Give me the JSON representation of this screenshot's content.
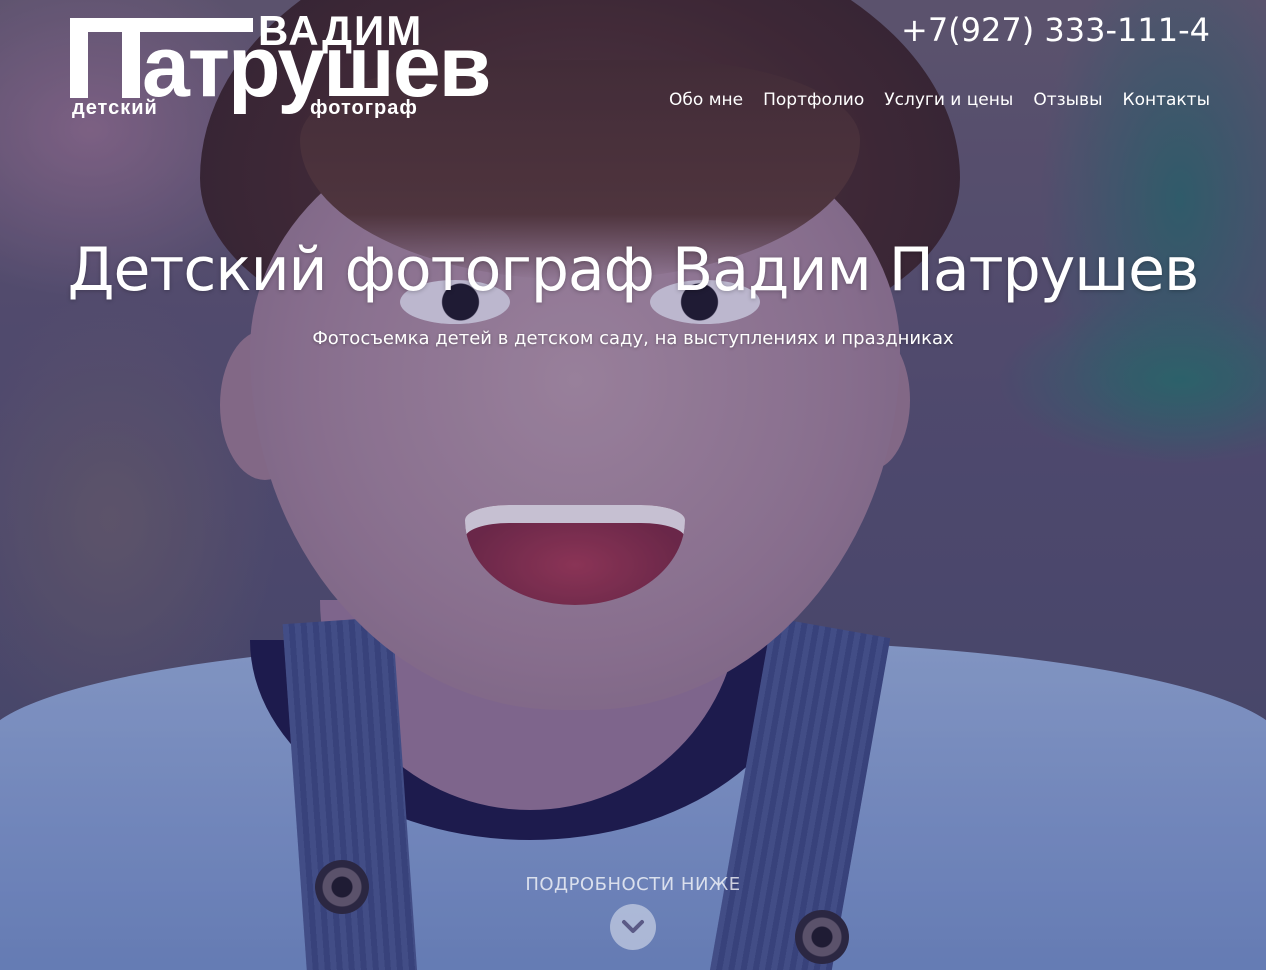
{
  "logo": {
    "firstname": "ВАДИМ",
    "lastname": "атрушев",
    "sub_left": "детский",
    "sub_right": "фотограф"
  },
  "header": {
    "phone": "+7(927) 333-111-4"
  },
  "nav": {
    "items": [
      {
        "label": "Обо мне"
      },
      {
        "label": "Портфолио"
      },
      {
        "label": "Услуги и цены"
      },
      {
        "label": "Отзывы"
      },
      {
        "label": "Контакты"
      }
    ]
  },
  "hero": {
    "title": "Детский фотограф Вадим Патрушев",
    "subtitle": "Фотосъемка детей в детском саду, на выступлениях и праздниках",
    "more_label": "ПОДРОБНОСТИ НИЖЕ",
    "more_icon": "chevron-down-icon"
  },
  "colors": {
    "text": "#ffffff",
    "overlay": "#281e5a"
  }
}
